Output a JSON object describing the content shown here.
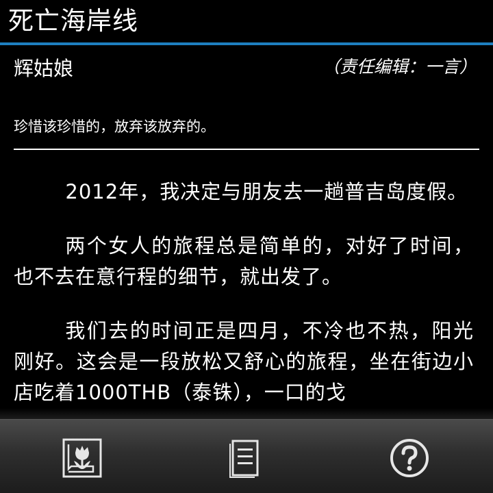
{
  "header": {
    "title": "死亡海岸线"
  },
  "meta": {
    "author": "辉姑娘",
    "editor": "（责任编辑：一言）",
    "subtitle": "珍惜该珍惜的，放弃该放弃的。"
  },
  "article": {
    "paragraphs": [
      "2012年，我决定与朋友去一趟普吉岛度假。",
      "两个女人的旅程总是简单的，对好了时间，也不去在意行程的细节，就出发了。",
      "我们去的时间正是四月，不冷也不热，阳光刚好。这会是一段放松又舒心的旅程，坐在街边小店吃着1000THB（泰铢），一口的戈"
    ]
  },
  "toolbar": {
    "icons": [
      "tulip-macro-icon",
      "document-icon",
      "help-icon"
    ]
  },
  "colors": {
    "background": "#000000",
    "accent": "#1e7fc0",
    "text": "#ffffff"
  }
}
